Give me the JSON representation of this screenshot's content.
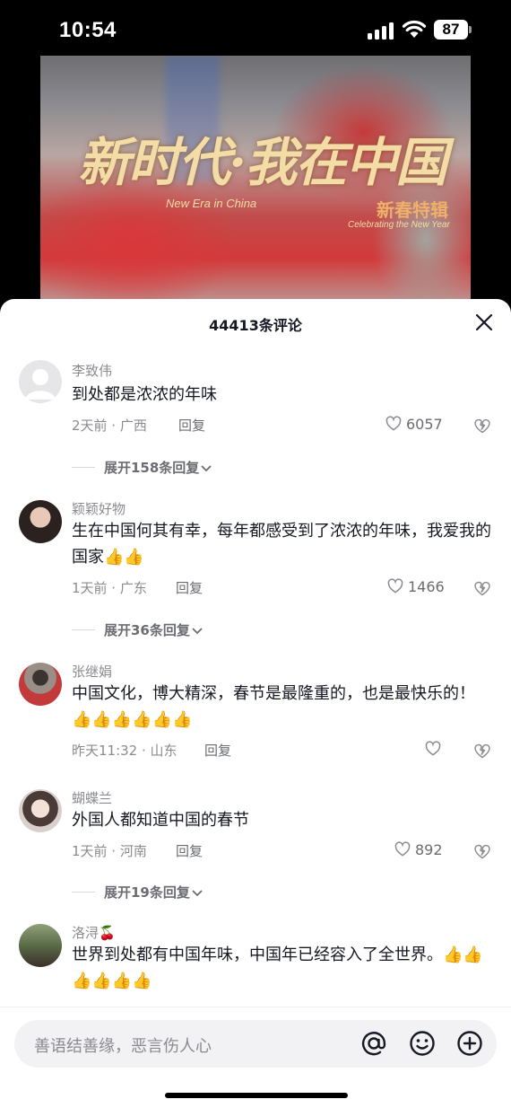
{
  "status_bar": {
    "time": "10:54",
    "battery": "87"
  },
  "video": {
    "title_cn": "新时代·我在中国",
    "title_en": "New Era in China",
    "sub_cn": "新春特辑",
    "sub_en": "Celebrating the New Year"
  },
  "comments_header": {
    "count_label": "44413条评论"
  },
  "comments": [
    {
      "name": "李致伟",
      "text": "到处都是浓浓的年味",
      "meta": "2天前 · 广西",
      "reply": "回复",
      "likes": "6057",
      "expand": "展开158条回复"
    },
    {
      "name": "颖颖好物",
      "text": "生在中国何其有幸，每年都感受到了浓浓的年味，我爱我的国家👍👍",
      "meta": "1天前 · 广东",
      "reply": "回复",
      "likes": "1466",
      "expand": "展开36条回复"
    },
    {
      "name": "张继娟",
      "text": "中国文化，博大精深，春节是最隆重的，也是最快乐的！👍👍👍👍👍👍",
      "meta": "昨天11:32 · 山东",
      "reply": "回复",
      "likes": ""
    },
    {
      "name": "蝴蝶兰",
      "text": "外国人都知道中国的春节",
      "meta": "1天前 · 河南",
      "reply": "回复",
      "likes": "892",
      "expand": "展开19条回复"
    },
    {
      "name": "洛浔🍒",
      "text": "世界到处都有中国年味，中国年已经容入了全世界。👍👍👍👍👍👍"
    }
  ],
  "input": {
    "placeholder": "善语结善缘，恶言伤人心"
  },
  "icons": [
    "signal-icon",
    "wifi-icon",
    "battery-icon",
    "close-icon",
    "heart-icon",
    "dislike-icon",
    "chevron-down-icon",
    "at-icon",
    "emoji-icon",
    "plus-icon"
  ]
}
